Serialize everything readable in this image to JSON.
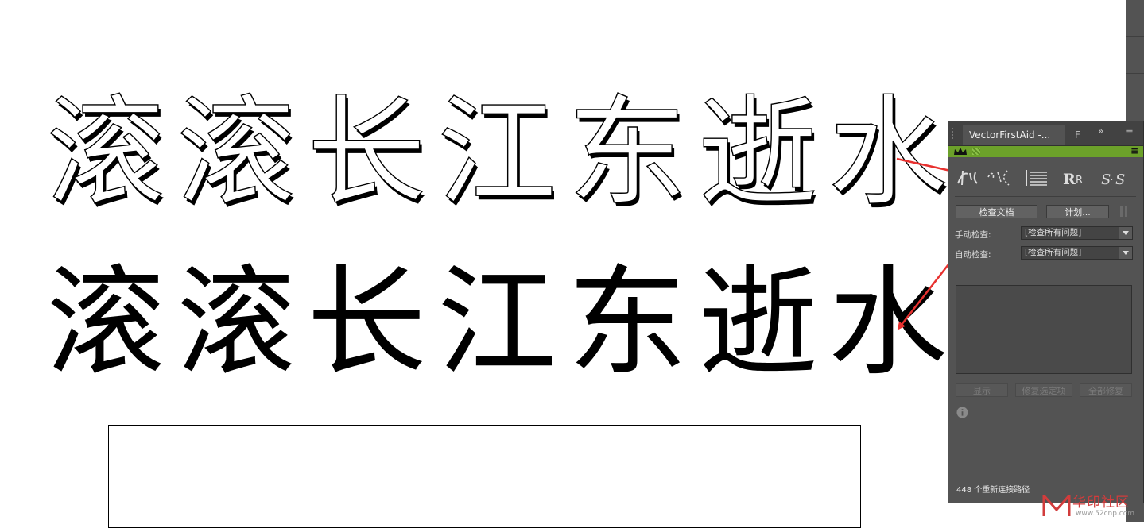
{
  "canvas": {
    "outline_text": "滚滚长江东逝水",
    "filled_text": "滚滚长江东逝水"
  },
  "panel": {
    "tabs": [
      {
        "label": "VectorFirstAid -..."
      },
      {
        "label": "F"
      }
    ],
    "tab_overflow": "»",
    "tab_menu": "≡",
    "brand_color": "#6ca12a",
    "tools": [
      "pen-path-icon",
      "stroke-icon",
      "align-lines-icon",
      "replace-r-icon",
      "swap-s-icon"
    ],
    "buttons": {
      "check_document": "检查文档",
      "plan": "计划...",
      "show": "显示",
      "fix_selected": "修复选定项",
      "fix_all": "全部修复"
    },
    "manual_check": {
      "label": "手动检查:",
      "value": "[检查所有问题]"
    },
    "auto_check": {
      "label": "自动检查:",
      "value": "[检查所有问题]"
    },
    "status": "448 个重新连接路径"
  },
  "watermark": {
    "name": "华印社区",
    "url": "www.52cnp.com"
  },
  "annotation_color": "#e8312f"
}
